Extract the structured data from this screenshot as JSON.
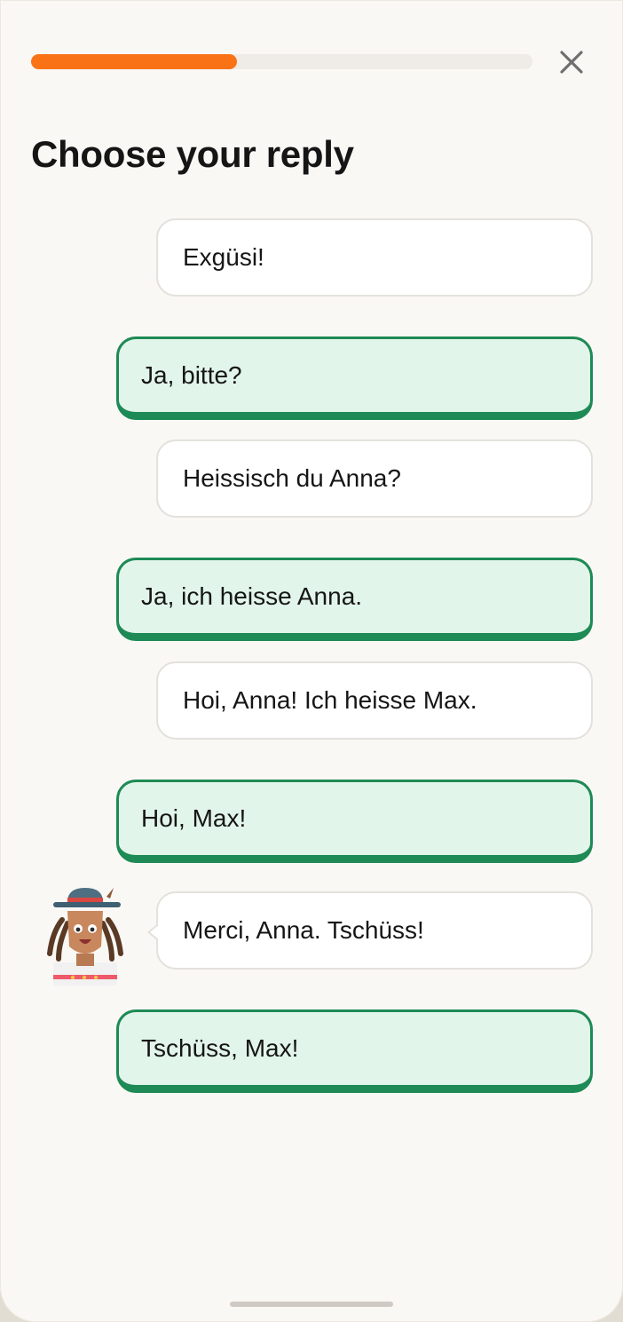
{
  "header": {
    "progress": 0.41,
    "close_icon": "close-icon"
  },
  "title": "Choose your reply",
  "messages": [
    {
      "speaker": "other",
      "text": "Exgüsi!"
    },
    {
      "speaker": "user",
      "text": "Ja, bitte?"
    },
    {
      "speaker": "other",
      "text": "Heissisch du Anna?"
    },
    {
      "speaker": "user",
      "text": "Ja, ich heisse Anna."
    },
    {
      "speaker": "other",
      "text": "Hoi, Anna! Ich heisse Max."
    },
    {
      "speaker": "user",
      "text": "Hoi, Max!"
    },
    {
      "speaker": "other",
      "text": "Merci, Anna. Tschüss!"
    },
    {
      "speaker": "user",
      "text": "Tschüss, Max!"
    }
  ],
  "colors": {
    "progress": "#f97316",
    "reply_border": "#1e8a55",
    "reply_bg": "#e2f5ea"
  }
}
